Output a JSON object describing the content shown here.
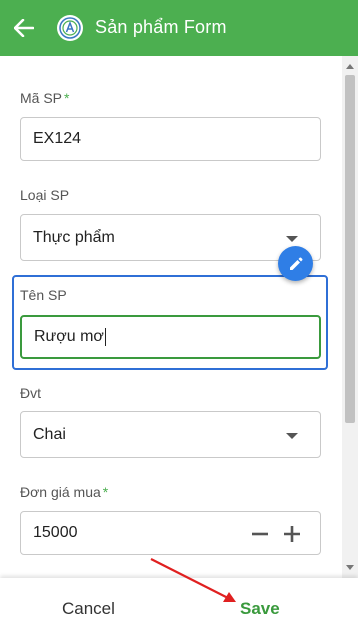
{
  "header": {
    "title": "Sản phẩm Form"
  },
  "form": {
    "ma_sp": {
      "label": "Mã SP",
      "required_mark": "*",
      "value": "EX124"
    },
    "loai_sp": {
      "label": "Loại SP",
      "value": "Thực phẩm"
    },
    "ten_sp": {
      "label": "Tên SP",
      "value": "Rượu mơ"
    },
    "dvt": {
      "label": "Đvt",
      "value": "Chai"
    },
    "don_gia_mua": {
      "label": "Đơn giá mua",
      "required_mark": "*",
      "value": "15000"
    }
  },
  "footer": {
    "cancel_label": "Cancel",
    "save_label": "Save"
  },
  "colors": {
    "primary": "#4caf50",
    "focus": "#2f6fd6",
    "fab": "#2f7ee6",
    "annotation_arrow": "#e02020"
  }
}
